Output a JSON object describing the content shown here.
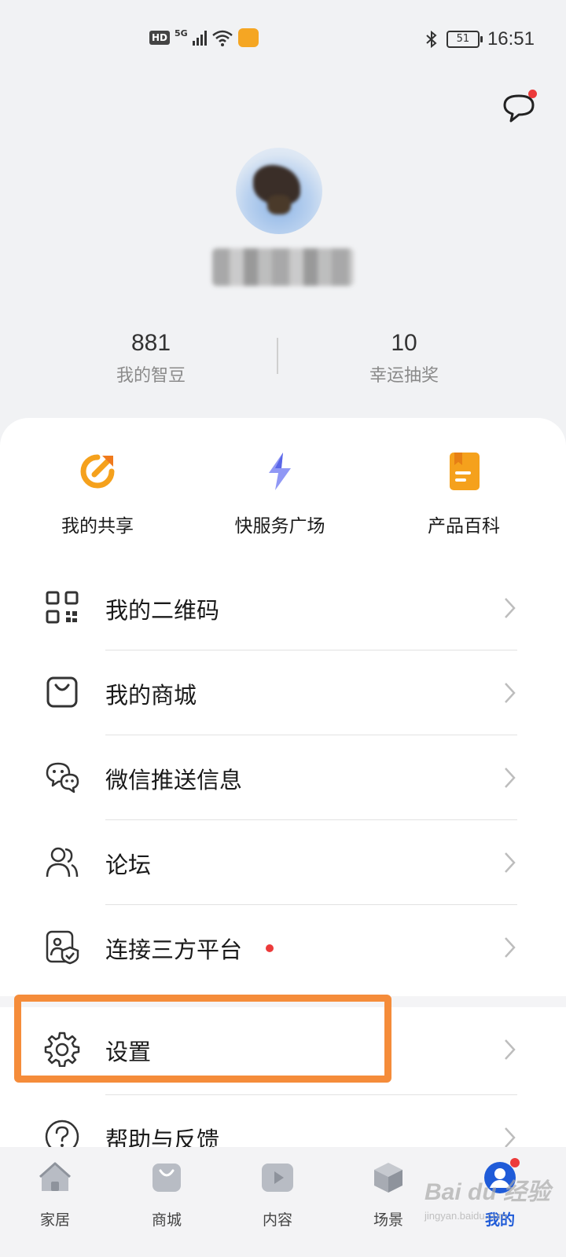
{
  "status_bar": {
    "hd": "HD",
    "network": "5G",
    "battery": "51",
    "time": "16:51"
  },
  "profile": {
    "stats": [
      {
        "value": "881",
        "label": "我的智豆"
      },
      {
        "value": "10",
        "label": "幸运抽奖"
      }
    ]
  },
  "quick_actions": [
    {
      "label": "我的共享",
      "icon": "share-icon",
      "color": "#f5a11c"
    },
    {
      "label": "快服务广场",
      "icon": "lightning-icon",
      "color": "#6e79f0"
    },
    {
      "label": "产品百科",
      "icon": "book-icon",
      "color": "#f5a11c"
    }
  ],
  "menu": [
    {
      "label": "我的二维码",
      "icon": "qrcode-icon"
    },
    {
      "label": "我的商城",
      "icon": "shopping-bag-icon"
    },
    {
      "label": "微信推送信息",
      "icon": "wechat-icon"
    },
    {
      "label": "论坛",
      "icon": "people-icon"
    },
    {
      "label": "连接三方平台",
      "icon": "third-party-icon",
      "badge": true
    },
    {
      "label": "设置",
      "icon": "gear-icon"
    },
    {
      "label": "帮助与反馈",
      "icon": "help-icon"
    }
  ],
  "bottom_nav": [
    {
      "label": "家居",
      "icon": "home-icon"
    },
    {
      "label": "商城",
      "icon": "bag-icon"
    },
    {
      "label": "内容",
      "icon": "play-icon"
    },
    {
      "label": "场景",
      "icon": "cube-icon"
    },
    {
      "label": "我的",
      "icon": "profile-icon",
      "active": true
    }
  ],
  "colors": {
    "accent": "#1f5bd8",
    "highlight": "#f58c3a",
    "badge": "#ec3a3a"
  },
  "watermark": {
    "line1": "Bai du 经验",
    "line2": "jingyan.baidu.com"
  }
}
